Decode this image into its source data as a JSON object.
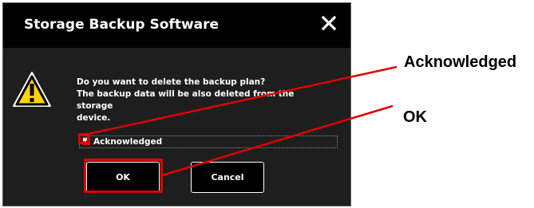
{
  "dialog": {
    "title": "Storage Backup Software",
    "message_line1": "Do you want to delete the backup plan?",
    "message_line2": "The backup data will be also deleted from the storage",
    "message_line3": "device.",
    "checkbox_label": "Acknowledged",
    "checkbox_checked": true,
    "ok_label": "OK",
    "cancel_label": "Cancel"
  },
  "annotations": {
    "acknowledged_callout": "Acknowledged",
    "ok_callout": "OK",
    "highlight_color": "#e00000"
  },
  "icons": {
    "close": "close-icon",
    "warning": "warning-icon",
    "check": "checkmark-icon"
  }
}
